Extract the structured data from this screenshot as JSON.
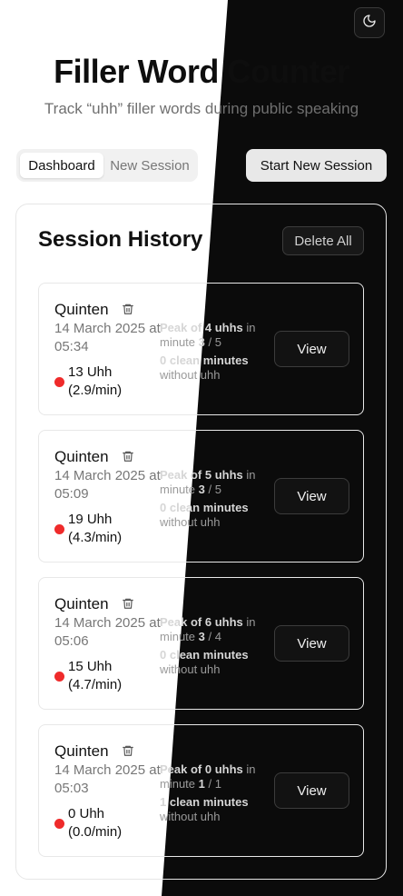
{
  "app": {
    "title": "Filler Word Counter",
    "subtitle": "Track “uhh” filler words during public speaking",
    "theme_toggle_icon": "moon-icon"
  },
  "tabs": [
    {
      "label": "Dashboard",
      "active": true
    },
    {
      "label": "New Session",
      "active": false
    }
  ],
  "start_button": "Start New Session",
  "history": {
    "title": "Session History",
    "delete_all": "Delete All",
    "view_label": "View",
    "peak_prefix": "Peak of",
    "peak_unit": "uhhs",
    "peak_in": "in",
    "minute_word": "minute",
    "clean_suffix": "clean minutes",
    "clean_note": "without uhh",
    "status_color": "#ef2b2b",
    "sessions": [
      {
        "name": "Quinten",
        "date": "14 March 2025 at",
        "time": "05:34",
        "count": "13 Uhh",
        "rate": "(2.9/min)",
        "peak": "4",
        "peak_minute": "3",
        "total_minutes": "5",
        "clean": "0"
      },
      {
        "name": "Quinten",
        "date": "14 March 2025 at",
        "time": "05:09",
        "count": "19 Uhh",
        "rate": "(4.3/min)",
        "peak": "5",
        "peak_minute": "3",
        "total_minutes": "5",
        "clean": "0"
      },
      {
        "name": "Quinten",
        "date": "14 March 2025 at",
        "time": "05:06",
        "count": "15 Uhh",
        "rate": "(4.7/min)",
        "peak": "6",
        "peak_minute": "3",
        "total_minutes": "4",
        "clean": "0"
      },
      {
        "name": "Quinten",
        "date": "14 March 2025 at",
        "time": "05:03",
        "count": "0 Uhh",
        "rate": "(0.0/min)",
        "peak": "0",
        "peak_minute": "1",
        "total_minutes": "1",
        "clean": "1"
      }
    ]
  }
}
